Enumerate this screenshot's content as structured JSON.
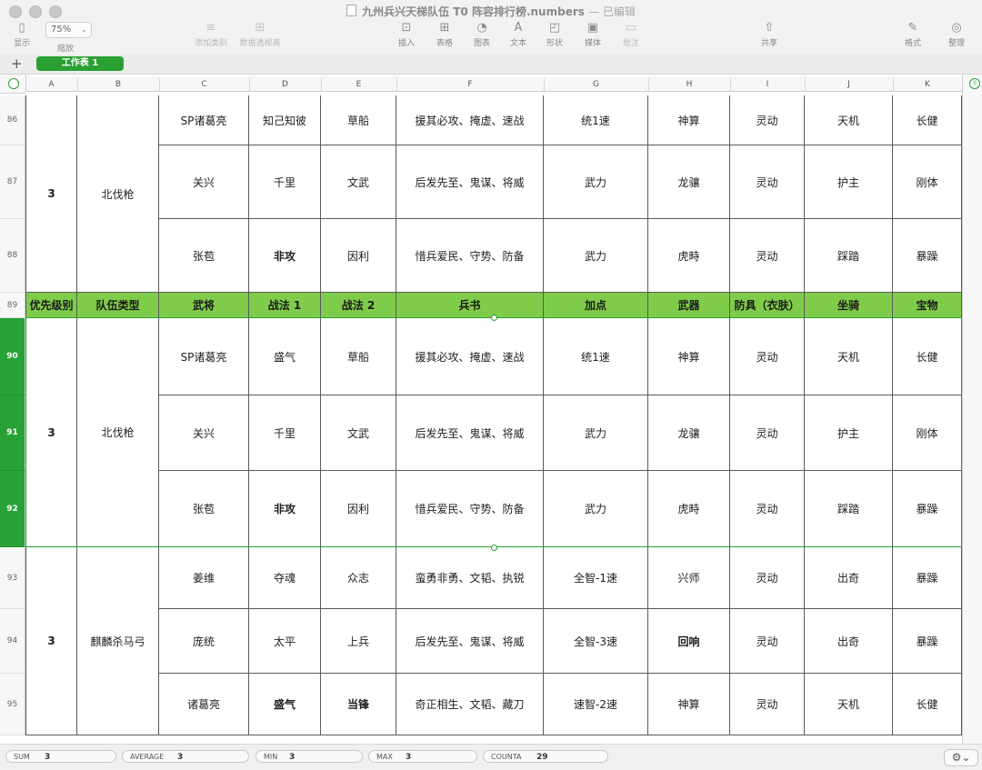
{
  "window": {
    "title": "九州兵兴天梯队伍 T0 阵容排行榜.numbers",
    "edited_status": "— 已编辑"
  },
  "toolbar": {
    "zoom_value": "75%",
    "items": [
      {
        "label": "显示",
        "icon": "sidebar-icon"
      },
      {
        "label": "缩放",
        "icon": "zoom-icon"
      },
      {
        "label": "添加类别",
        "icon": "add-category-icon"
      },
      {
        "label": "数据透视表",
        "icon": "pivot-table-icon"
      },
      {
        "label": "插入",
        "icon": "insert-icon"
      },
      {
        "label": "表格",
        "icon": "table-icon"
      },
      {
        "label": "图表",
        "icon": "chart-icon"
      },
      {
        "label": "文本",
        "icon": "text-icon"
      },
      {
        "label": "形状",
        "icon": "shape-icon"
      },
      {
        "label": "媒体",
        "icon": "media-icon"
      },
      {
        "label": "批注",
        "icon": "comment-icon"
      },
      {
        "label": "共享",
        "icon": "share-icon"
      },
      {
        "label": "格式",
        "icon": "format-icon"
      },
      {
        "label": "整理",
        "icon": "organize-icon"
      }
    ]
  },
  "sheets": {
    "add_label": "+",
    "tabs": [
      "工作表 1"
    ]
  },
  "columns": [
    "A",
    "B",
    "C",
    "D",
    "E",
    "F",
    "G",
    "H",
    "I",
    "J",
    "K"
  ],
  "rows": {
    "r86": {
      "num": "86",
      "cells": [
        "SP诸葛亮",
        "知己知彼",
        "草船",
        "援其必攻、掩虚、速战",
        "统1速",
        "神算",
        "灵动",
        "天机",
        "长健"
      ]
    },
    "r87": {
      "num": "87",
      "cells": [
        "关兴",
        "千里",
        "文武",
        "后发先至、鬼谋、将威",
        "武力",
        "龙骧",
        "灵动",
        "护主",
        "刚体"
      ]
    },
    "r88": {
      "num": "88",
      "cells": [
        "张苞",
        "非攻",
        "因利",
        "惜兵爱民、守势、防备",
        "武力",
        "虎畤",
        "灵动",
        "踩踏",
        "暴躁"
      ]
    },
    "r89": {
      "num": "89",
      "cells": [
        "优先级别",
        "队伍类型",
        "武将",
        "战法 1",
        "战法 2",
        "兵书",
        "加点",
        "武器",
        "防具（衣肤）",
        "坐骑",
        "宝物"
      ]
    },
    "r90": {
      "num": "90",
      "cells": [
        "SP诸葛亮",
        "盛气",
        "草船",
        "援其必攻、掩虚、速战",
        "统1速",
        "神算",
        "灵动",
        "天机",
        "长健"
      ]
    },
    "r91": {
      "num": "91",
      "cells": [
        "关兴",
        "千里",
        "文武",
        "后发先至、鬼谋、将威",
        "武力",
        "龙骧",
        "灵动",
        "护主",
        "刚体"
      ]
    },
    "r92": {
      "num": "92",
      "cells": [
        "张苞",
        "非攻",
        "因利",
        "惜兵爱民、守势、防备",
        "武力",
        "虎畤",
        "灵动",
        "踩踏",
        "暴躁"
      ]
    },
    "r93": {
      "num": "93",
      "cells": [
        "姜维",
        "夺魂",
        "众志",
        "蛮勇非勇、文韬、执锐",
        "全智-1速",
        "兴师",
        "灵动",
        "出奇",
        "暴躁"
      ]
    },
    "r94": {
      "num": "94",
      "cells": [
        "庞统",
        "太平",
        "上兵",
        "后发先至、鬼谋、将威",
        "全智-3速",
        "回响",
        "灵动",
        "出奇",
        "暴躁"
      ]
    },
    "r95": {
      "num": "95",
      "cells": [
        "诸葛亮",
        "盛气",
        "当锋",
        "奇正相生、文韬、藏刀",
        "速智-2速",
        "神算",
        "灵动",
        "天机",
        "长健"
      ]
    }
  },
  "groups": {
    "g1": {
      "priority": "3",
      "team_type": "北伐枪"
    },
    "g2": {
      "priority": "3",
      "team_type": "北伐枪"
    },
    "g3": {
      "priority": "3",
      "team_type": "麒麟杀马弓"
    }
  },
  "status": {
    "sum_label": "SUM",
    "sum_value": "3",
    "avg_label": "AVERAGE",
    "avg_value": "3",
    "min_label": "MIN",
    "min_value": "3",
    "max_label": "MAX",
    "max_value": "3",
    "counta_label": "COUNTA",
    "counta_value": "29"
  },
  "colors": {
    "accent_green": "#2aa033",
    "header_green": "#7fcc4a"
  }
}
